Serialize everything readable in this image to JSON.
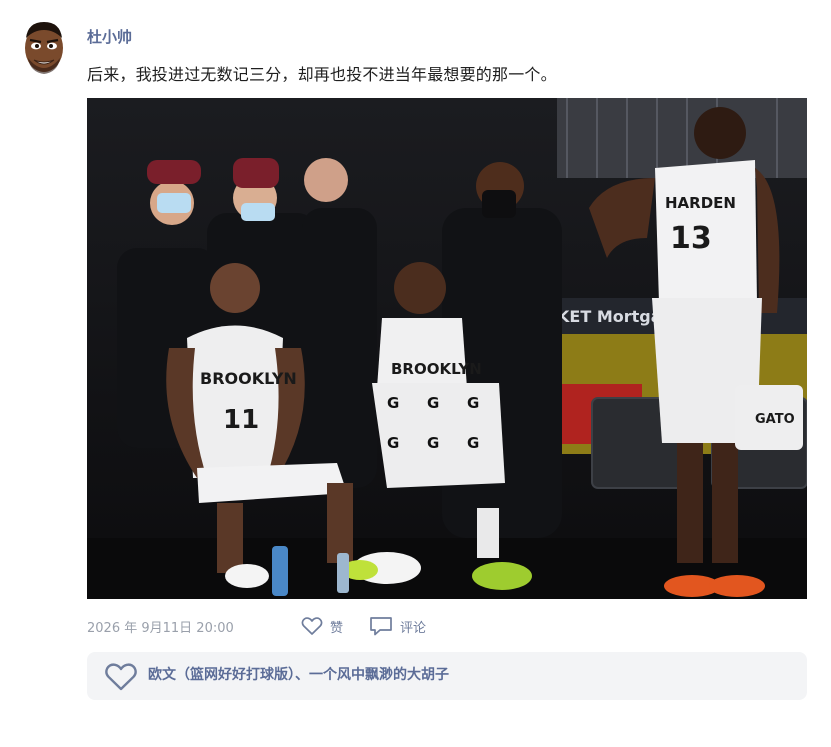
{
  "post": {
    "author": "杜小帅",
    "text": "后来，我投进过无数记三分，却再也投不进当年最想要的那一个。",
    "timestamp": "2026 年 9月11日 20:00"
  },
  "actions": {
    "like_label": "赞",
    "comment_label": "评论"
  },
  "likes": {
    "names": "欧文（篮网好好打球版）、一个风中飘渺的大胡子"
  },
  "photo": {
    "jersey_labels": [
      "BROOKLYN",
      "BROOKLYN",
      "HARDEN"
    ],
    "jersey_numbers": [
      "11",
      "13"
    ],
    "signage_text": "KET Mortga",
    "towel_text": "GATO"
  },
  "colors": {
    "accent": "#5b6c97",
    "action": "#6f7d9c",
    "meta": "#9aa0ab",
    "panel": "#f3f4f6"
  }
}
